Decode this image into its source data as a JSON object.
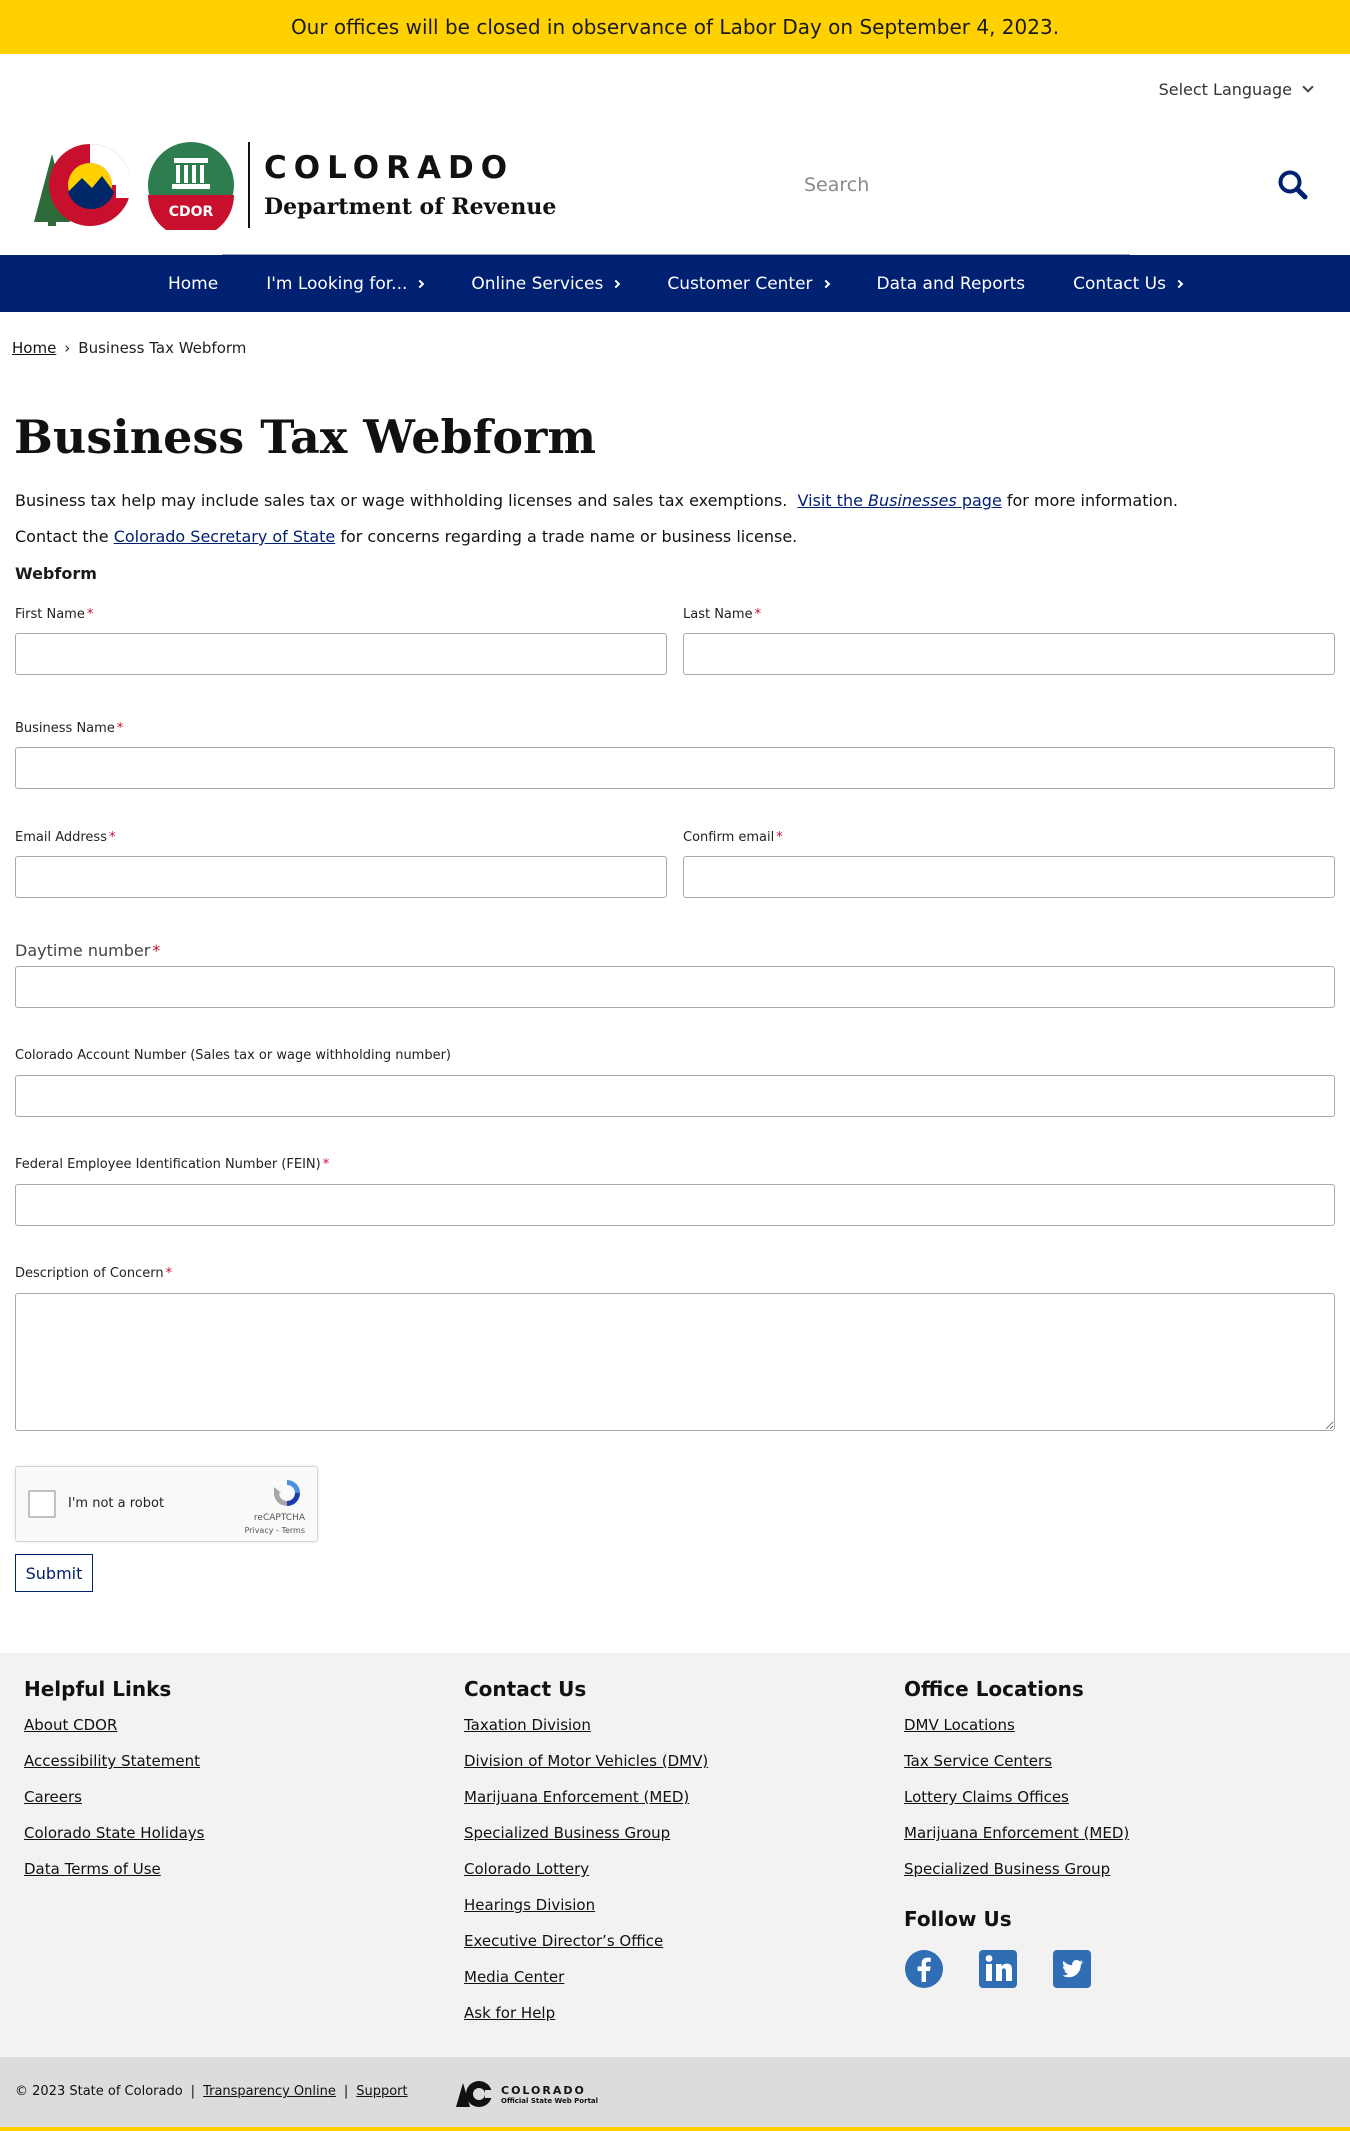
{
  "alert": {
    "text": "Our offices will be closed in observance of Labor Day on September 4, 2023."
  },
  "language": {
    "label": "Select Language"
  },
  "brand": {
    "state": "COLORADO",
    "department": "Department of Revenue",
    "seal_text": "CDOR"
  },
  "search": {
    "placeholder": "Search"
  },
  "nav": {
    "items": [
      {
        "label": "Home",
        "has_submenu": false
      },
      {
        "label": "I'm Looking for...",
        "has_submenu": true
      },
      {
        "label": "Online Services",
        "has_submenu": true
      },
      {
        "label": "Customer Center",
        "has_submenu": true
      },
      {
        "label": "Data and Reports",
        "has_submenu": false
      },
      {
        "label": "Contact Us",
        "has_submenu": true
      }
    ]
  },
  "breadcrumb": {
    "home": "Home",
    "current": "Business Tax Webform"
  },
  "page": {
    "title": "Business Tax Webform",
    "intro1_text": "Business tax help may include sales tax or wage withholding licenses and sales tax exemptions.",
    "intro1_link_pre": "Visit the ",
    "intro1_link_em": "Businesses",
    "intro1_link_post": " page",
    "intro1_tail": " for more information.",
    "intro2_pre": "Contact the ",
    "intro2_link": "Colorado Secretary of State",
    "intro2_post": " for concerns regarding a trade name or business license."
  },
  "form": {
    "section_label": "Webform",
    "required_mark": "*",
    "first_name": {
      "label": "First Name",
      "value": ""
    },
    "last_name": {
      "label": "Last Name",
      "value": ""
    },
    "business_name": {
      "label": "Business Name",
      "value": ""
    },
    "email": {
      "label": "Email Address",
      "value": ""
    },
    "confirm_email": {
      "label": "Confirm email",
      "value": ""
    },
    "daytime_number": {
      "label": "Daytime number",
      "value": ""
    },
    "account_number": {
      "label": "Colorado Account Number (Sales tax or wage withholding number)",
      "value": ""
    },
    "fein": {
      "label": "Federal Employee Identification Number (FEIN)",
      "value": ""
    },
    "description": {
      "label": "Description of Concern",
      "value": ""
    },
    "captcha": {
      "label": "I'm not a robot",
      "brand": "reCAPTCHA",
      "terms": "Privacy - Terms"
    },
    "submit_label": "Submit"
  },
  "footer": {
    "helpful": {
      "heading": "Helpful Links",
      "links": [
        "About CDOR",
        "Accessibility Statement",
        "Careers",
        "Colorado State Holidays",
        "Data Terms of Use"
      ]
    },
    "contact": {
      "heading": "Contact Us",
      "links": [
        "Taxation Division",
        "Division of Motor Vehicles (DMV)",
        "Marijuana Enforcement (MED)",
        "Specialized Business Group",
        "Colorado Lottery",
        "Hearings Division",
        "Executive Director’s Office",
        "Media Center",
        "Ask for Help"
      ]
    },
    "offices": {
      "heading": "Office Locations",
      "links": [
        "DMV Locations",
        "Tax Service Centers",
        "Lottery Claims Offices",
        "Marijuana Enforcement (MED)",
        "Specialized Business Group"
      ]
    },
    "follow": {
      "heading": "Follow Us",
      "icons": [
        "facebook-icon",
        "linkedin-icon",
        "twitter-icon"
      ]
    }
  },
  "bottom": {
    "copyright": "© 2023 State of Colorado",
    "separator": "|",
    "transparency": "Transparency Online",
    "support": "Support",
    "portal_line1": "COLORADO",
    "portal_line2": "Official State Web Portal"
  },
  "colors": {
    "alert": "#ffd100",
    "nav": "#002071",
    "required": "#c8102e",
    "footer_bg": "#f2f2f2",
    "social": "#2f6db5"
  }
}
